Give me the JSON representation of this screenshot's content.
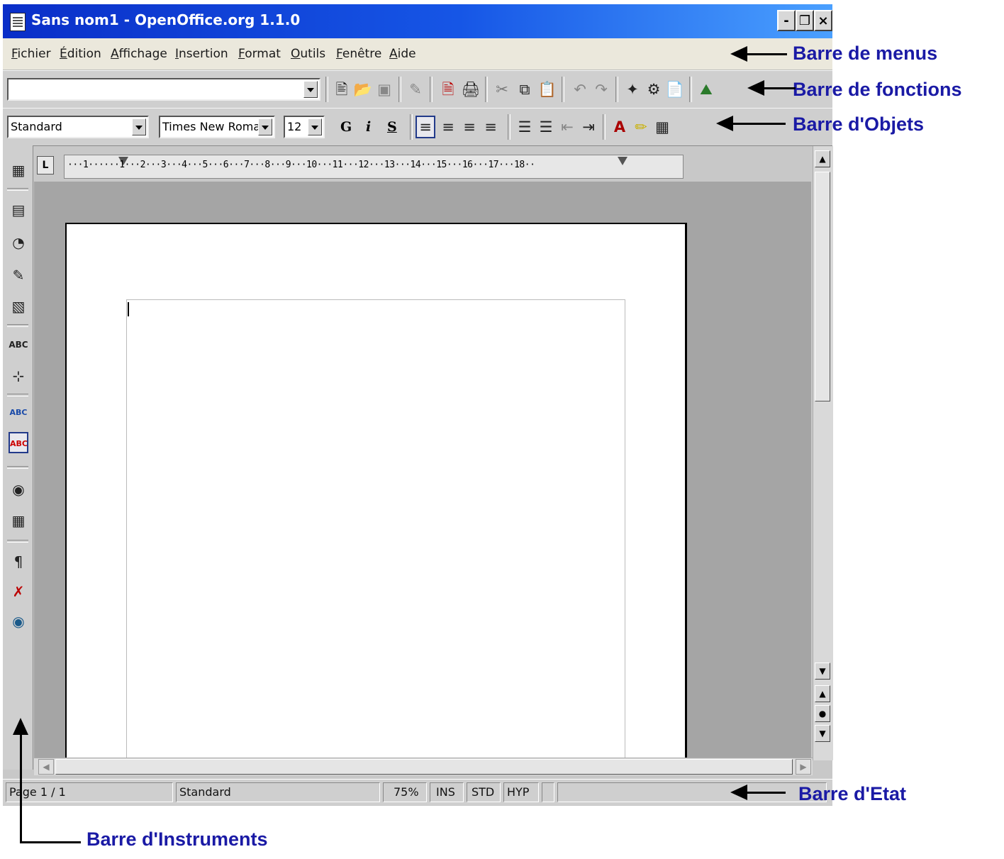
{
  "window": {
    "title": "Sans nom1 - OpenOffice.org 1.1.0",
    "controls": {
      "minimize": "-",
      "restore": "❐",
      "close": "×"
    }
  },
  "menubar": {
    "items": [
      "Fichier",
      "Édition",
      "Affichage",
      "Insertion",
      "Format",
      "Outils",
      "Fenêtre",
      "Aide"
    ]
  },
  "funcbar": {
    "url_value": "",
    "icons": [
      "new-document",
      "open-folder",
      "save-disk",
      "edit-file",
      "export-pdf",
      "print",
      "cut",
      "copy",
      "paste",
      "undo",
      "redo",
      "navigator",
      "stylist",
      "gallery",
      "data-sources"
    ]
  },
  "objbar": {
    "style": "Standard",
    "font": "Times New Roman",
    "size": "12",
    "bold": "G",
    "italic": "i",
    "underline": "S"
  },
  "instruments": {
    "icons": [
      "insert-table",
      "insert-frame",
      "insert-chart",
      "draw",
      "form-fields",
      "text-autocorrect",
      "text-cursor",
      "spell-check",
      "auto-spell",
      "find-binoculars",
      "data-table",
      "nonprinting-chars",
      "remove-formatting",
      "3d-object"
    ]
  },
  "ruler": {
    "corner": "L",
    "scale": "···1······1···2···3···4···5···6···7···8···9···10···11···12···13···14···15···16···17···18··"
  },
  "statusbar": {
    "page": "Page 1 / 1",
    "style": "Standard",
    "zoom": "75%",
    "ins": "INS",
    "std": "STD",
    "hyp": "HYP"
  },
  "annotations": {
    "menus": "Barre de menus",
    "functions": "Barre de fonctions",
    "objects": "Barre d'Objets",
    "status": "Barre d'Etat",
    "instruments": "Barre d'Instruments"
  },
  "colors": {
    "titlebar_start": "#0a2ec8",
    "titlebar_end": "#4aa0ff",
    "annotation_text": "#1a1aa5",
    "workspace": "#a5a5a5"
  }
}
